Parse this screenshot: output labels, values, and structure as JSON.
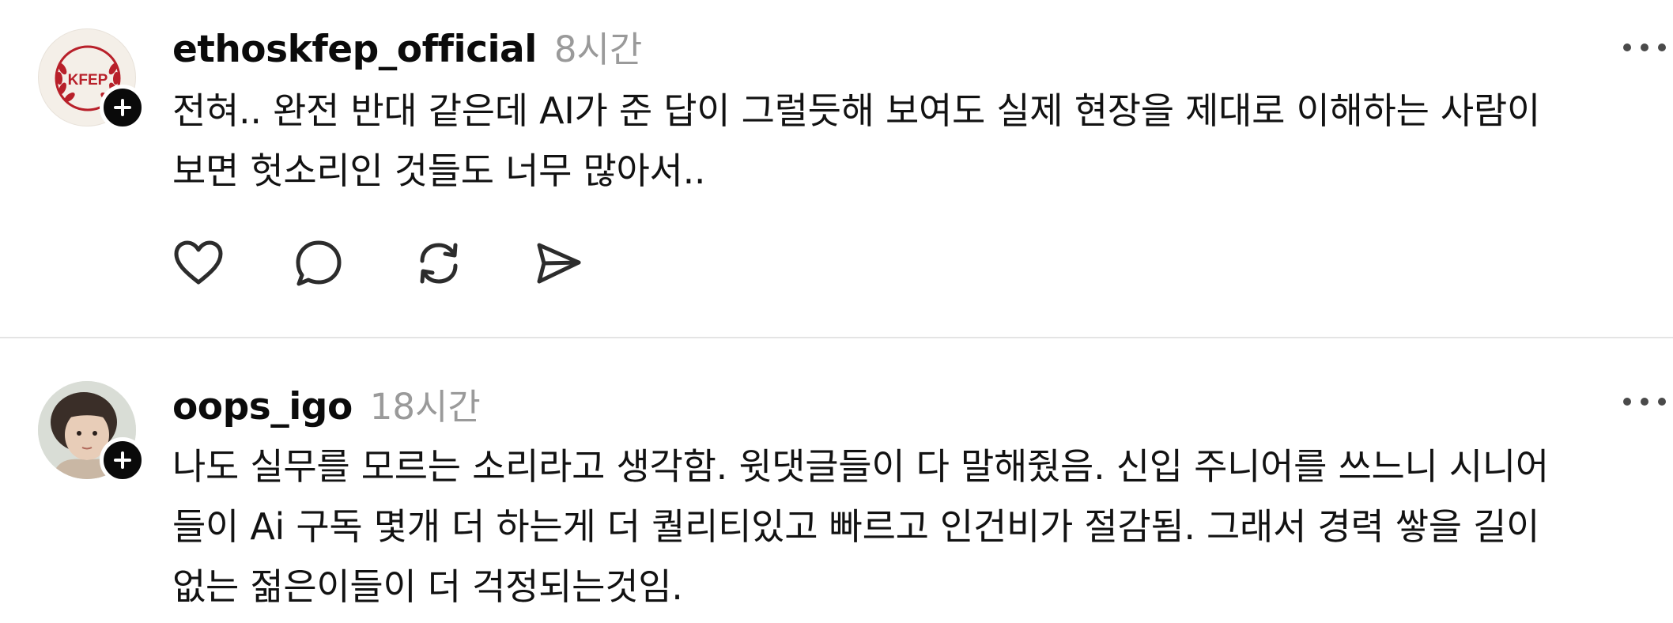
{
  "posts": [
    {
      "username": "ethoskfep_official",
      "time": "8시간",
      "avatar_text": "KFEP",
      "body": "전혀.. 완전 반대 같은데 AI가 준 답이 그럴듯해 보여도 실제 현장을 제대로 이해하는 사람이\n보면 헛소리인 것들도 너무 많아서..",
      "actions": [
        "heart-icon",
        "comment-icon",
        "repost-icon",
        "share-icon"
      ]
    },
    {
      "username": "oops_igo",
      "time": "18시간",
      "body": "나도 실무를 모르는 소리라고 생각함. 윗댓글들이 다 말해줬음. 신입 주니어를 쓰느니 시니어\n들이 Ai 구독 몇개 더 하는게 더 퀄리티있고 빠르고 인건비가 절감됨. 그래서 경력 쌓을 길이\n없는 젊은이들이 더 걱정되는것임."
    }
  ]
}
